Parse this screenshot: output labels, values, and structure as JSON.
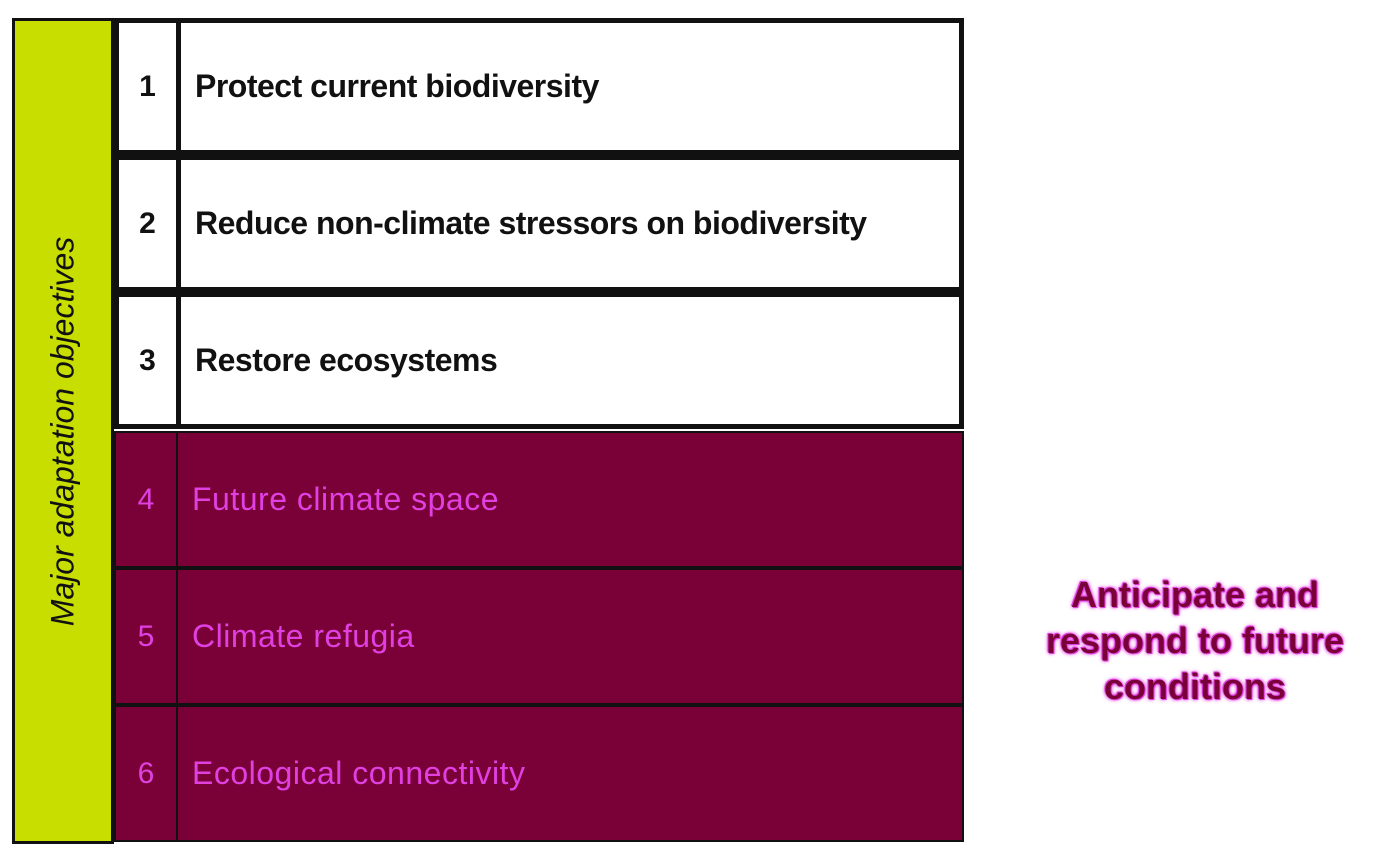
{
  "side_label": "Major adaptation objectives",
  "objectives_upper": [
    {
      "num": "1",
      "text": "Protect current biodiversity"
    },
    {
      "num": "2",
      "text": "Reduce non-climate stressors on biodiversity"
    },
    {
      "num": "3",
      "text": "Restore ecosystems"
    }
  ],
  "objectives_lower": [
    {
      "num": "4",
      "text": "Future climate space"
    },
    {
      "num": "5",
      "text": "Climate refugia"
    },
    {
      "num": "6",
      "text": "Ecological connectivity"
    }
  ],
  "callout": "Anticipate and respond to future conditions",
  "colors": {
    "side_bar": "#c8de00",
    "lower_block": "#7a0038",
    "lower_text": "#e040e0"
  }
}
